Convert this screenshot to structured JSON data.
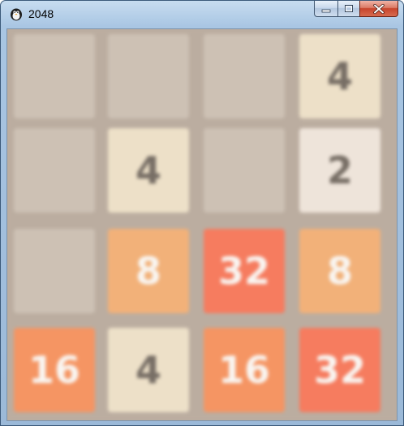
{
  "window": {
    "title": "2048",
    "app_icon": "penguin-icon",
    "caption_buttons": [
      "minimize-icon",
      "maximize-icon",
      "close-icon"
    ]
  },
  "board": {
    "rows": [
      [
        "",
        "",
        "",
        "4"
      ],
      [
        "",
        "4",
        "",
        "2"
      ],
      [
        "",
        "8",
        "32",
        "8"
      ],
      [
        "16",
        "4",
        "16",
        "32"
      ]
    ]
  },
  "colors": {
    "board_bg": "#bbada0",
    "empty": "#cdc1b4",
    "tile_2": "#eee4da",
    "tile_4": "#ede0c8",
    "tile_8": "#f2b179",
    "tile_16": "#f59563",
    "tile_32": "#f67c5f",
    "dark_text": "#776e65",
    "light_text": "#f9f6f2"
  }
}
